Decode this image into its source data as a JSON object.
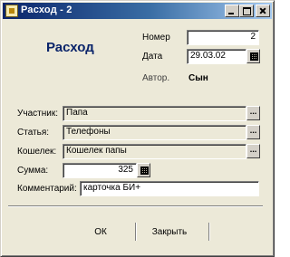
{
  "window": {
    "title": "Расход - 2"
  },
  "header": {
    "heading": "Расход"
  },
  "fields": {
    "number": {
      "label": "Номер",
      "value": "2"
    },
    "date": {
      "label": "Дата",
      "value": "29.03.02"
    },
    "author": {
      "label": "Автор.",
      "value": "Сын"
    },
    "participant": {
      "label": "Участник:",
      "value": "Папа"
    },
    "article": {
      "label": "Статья:",
      "value": "Телефоны"
    },
    "wallet": {
      "label": "Кошелек:",
      "value": "Кошелек папы"
    },
    "amount": {
      "label": "Сумма:",
      "value": "325"
    },
    "comment": {
      "label": "Комментарий:",
      "value": "карточка БИ+"
    }
  },
  "buttons": {
    "ellipsis": "...",
    "ok": "ОК",
    "close": "Закрыть"
  },
  "icons": {
    "window": "document-icon",
    "calendar": "calendar-icon",
    "calculator": "calculator-icon"
  }
}
